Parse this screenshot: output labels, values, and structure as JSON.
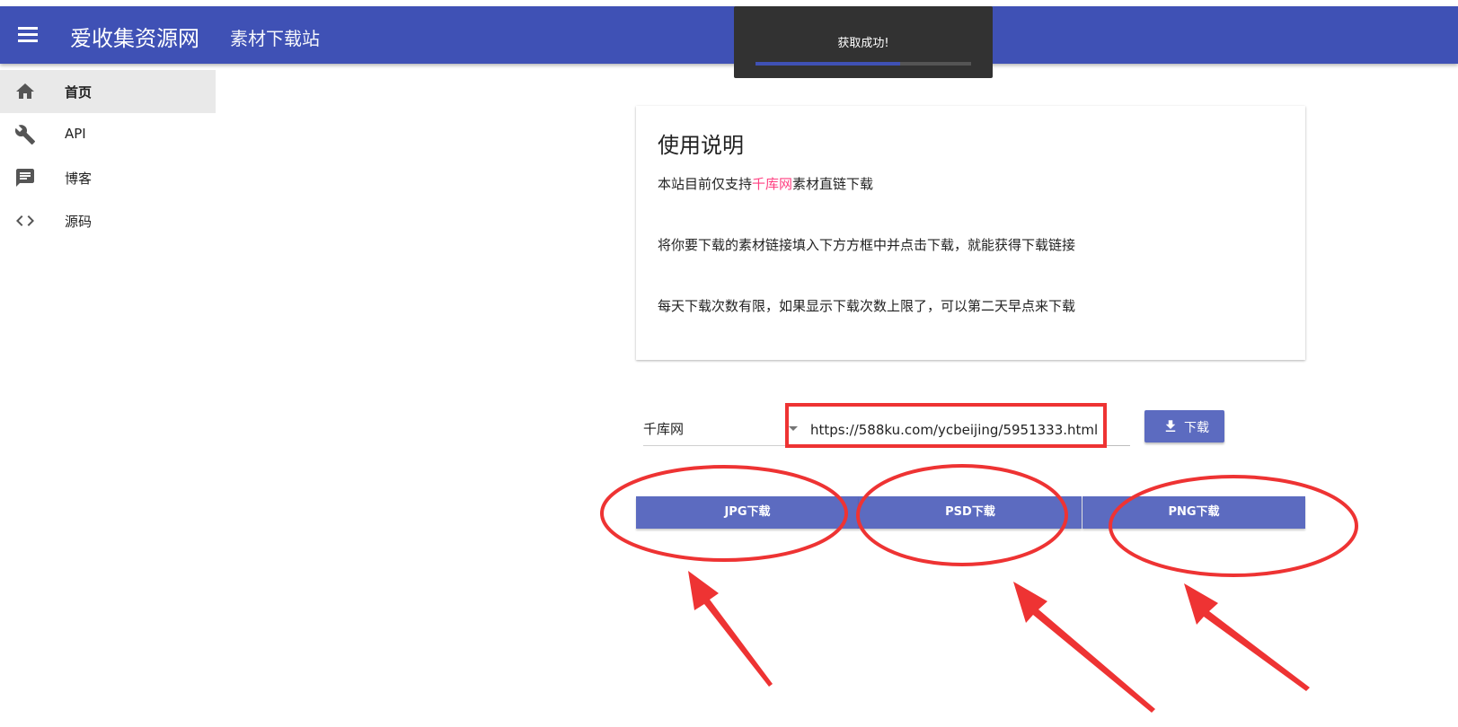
{
  "appbar": {
    "brand": "爱收集资源网",
    "subtitle": "素材下载站"
  },
  "sidebar": {
    "items": [
      {
        "label": "首页",
        "icon": "home-icon"
      },
      {
        "label": "API",
        "icon": "wrench-icon"
      },
      {
        "label": "博客",
        "icon": "comment-icon"
      },
      {
        "label": "源码",
        "icon": "code-icon"
      }
    ]
  },
  "toast": {
    "message": "获取成功!",
    "progress": 0.67
  },
  "instructions": {
    "title": "使用说明",
    "line1_prefix": "本站目前仅支持",
    "line1_highlight": "千库网",
    "line1_suffix": "素材直链下载",
    "line2": "将你要下载的素材链接填入下方方框中并点击下载，就能获得下载链接",
    "line3": "每天下载次数有限，如果显示下载次数上限了，可以第二天早点来下载"
  },
  "form": {
    "site_selected": "千库网",
    "url_value": "https://588ku.com/ycbeijing/5951333.html",
    "download_label": "下载"
  },
  "formats": {
    "jpg": "JPG下载",
    "psd": "PSD下载",
    "png": "PNG下载"
  },
  "colors": {
    "primary": "#3f51b5",
    "button": "#5c6bc0",
    "accent": "#ff4081",
    "annotation": "#ee3333"
  }
}
